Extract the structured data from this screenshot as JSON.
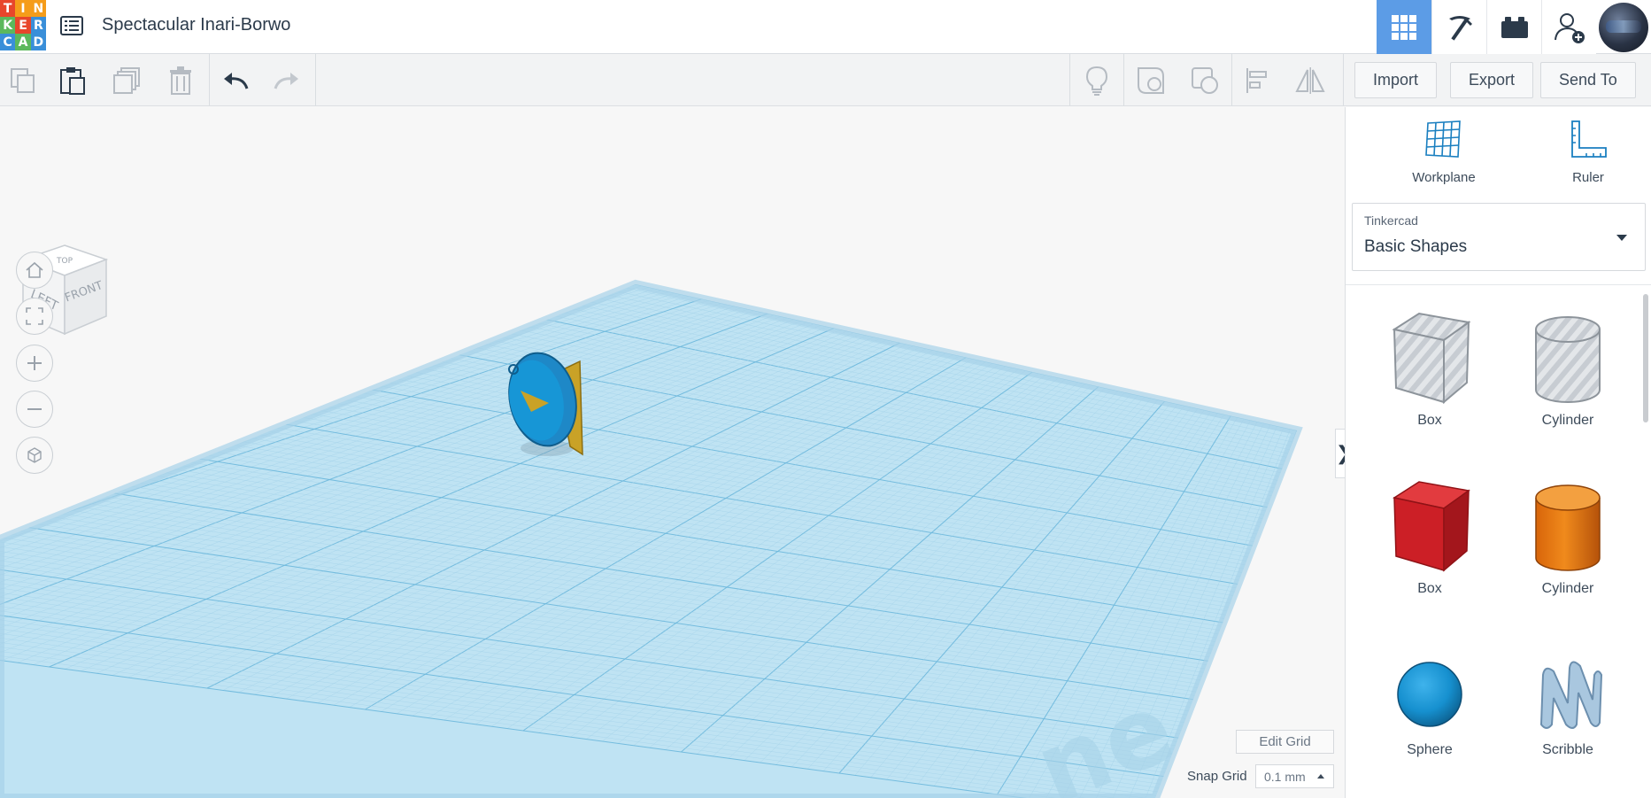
{
  "header": {
    "logo_letters": [
      "T",
      "I",
      "N",
      "K",
      "E",
      "R",
      "C",
      "A",
      "D"
    ],
    "logo_colors": [
      "#e8462b",
      "#f59c1a",
      "#f59c1a",
      "#5cb85c",
      "#e8462b",
      "#3a8fd9",
      "#3a8fd9",
      "#5cb85c",
      "#3a8fd9"
    ],
    "design_title": "Spectacular Inari-Borwo",
    "active_view_color": "#5c9ce6"
  },
  "toolbar": {
    "import_label": "Import",
    "export_label": "Export",
    "send_to_label": "Send To"
  },
  "viewport": {
    "viewcube": {
      "top_label": "TOP",
      "left_label": "LEFT",
      "front_label": "FRONT"
    },
    "edit_grid_label": "Edit Grid",
    "snap_grid_label": "Snap Grid",
    "snap_grid_value": "0.1 mm",
    "workplane_color": "#bfe3f3"
  },
  "sidebar": {
    "workplane_label": "Workplane",
    "ruler_label": "Ruler",
    "library": {
      "category": "Tinkercad",
      "value": "Basic Shapes"
    },
    "shapes": [
      {
        "name": "Box",
        "icon": "box-hole-icon"
      },
      {
        "name": "Cylinder",
        "icon": "cylinder-hole-icon"
      },
      {
        "name": "Box",
        "icon": "box-red-icon"
      },
      {
        "name": "Cylinder",
        "icon": "cylinder-orange-icon"
      },
      {
        "name": "Sphere",
        "icon": "sphere-blue-icon"
      },
      {
        "name": "Scribble",
        "icon": "scribble-icon"
      }
    ]
  }
}
